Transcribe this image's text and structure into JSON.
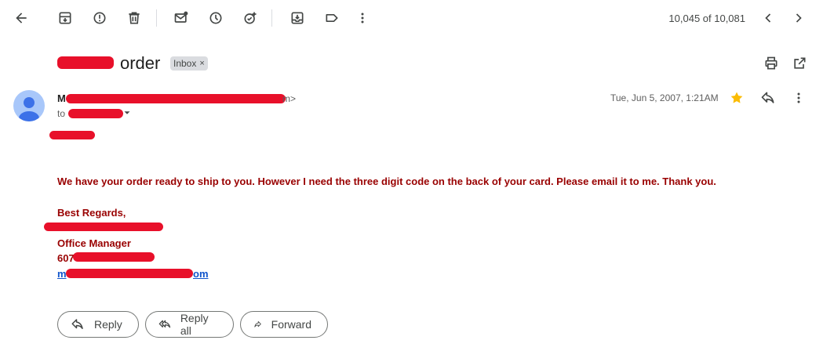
{
  "toolbar": {
    "icons": [
      "back-arrow-icon",
      "archive-icon",
      "report-spam-icon",
      "delete-icon",
      "mark-unread-icon",
      "snooze-icon",
      "add-task-icon",
      "move-to-icon",
      "label-icon",
      "more-vert-icon"
    ],
    "counter": "10,045 of 10,081"
  },
  "email": {
    "subject_visible": "order",
    "label": "Inbox",
    "sender_initial": "M",
    "sender_email_tail": "m>",
    "to_prefix": "to",
    "date": "Tue, Jun 5, 2007, 1:21AM",
    "star_color": "#fbbc04",
    "body": {
      "message": "We have your order ready to ship to you.  However I need the three digit code on the back of your card.  Please email it to me.  Thank you.",
      "regards": "Best Regards,",
      "title": "Office Manager",
      "phone_prefix": "607",
      "email_prefix": "m",
      "email_suffix": "om"
    },
    "text_color": "#990000",
    "redaction_color": "#e8102a"
  },
  "actions": {
    "reply": "Reply",
    "reply_all": "Reply all",
    "forward": "Forward"
  }
}
